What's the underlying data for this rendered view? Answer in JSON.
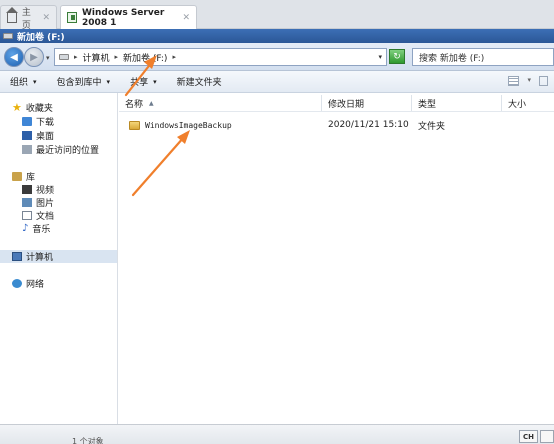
{
  "tabs": [
    {
      "label": "主页",
      "close": "✕"
    },
    {
      "label": "Windows Server 2008 1",
      "close": "✕"
    }
  ],
  "window": {
    "title": "新加卷 (F:)"
  },
  "address": {
    "crumbs": [
      "计算机",
      "新加卷 (F:)"
    ],
    "search_placeholder": "搜索 新加卷 (F:)"
  },
  "commands": [
    {
      "label": "组织",
      "dropdown": true
    },
    {
      "label": "包含到库中",
      "dropdown": true
    },
    {
      "label": "共享",
      "dropdown": true
    },
    {
      "label": "新建文件夹",
      "dropdown": false
    }
  ],
  "nav": {
    "favorites": {
      "label": "收藏夹",
      "items": [
        "下载",
        "桌面",
        "最近访问的位置"
      ]
    },
    "libraries": {
      "label": "库",
      "items": [
        "视频",
        "图片",
        "文档",
        "音乐"
      ]
    },
    "computer": "计算机",
    "network": "网络"
  },
  "columns": {
    "name": "名称",
    "date": "修改日期",
    "type": "类型",
    "size": "大小"
  },
  "files": [
    {
      "name": "WindowsImageBackup",
      "date": "2020/11/21 15:10",
      "type": "文件夹",
      "size": ""
    }
  ],
  "status": {
    "text": "1 个对象",
    "ime": "CH"
  },
  "colors": {
    "accent": "#2b5797",
    "arrow": "#f07f2c",
    "selection": "#d9e4f1"
  }
}
